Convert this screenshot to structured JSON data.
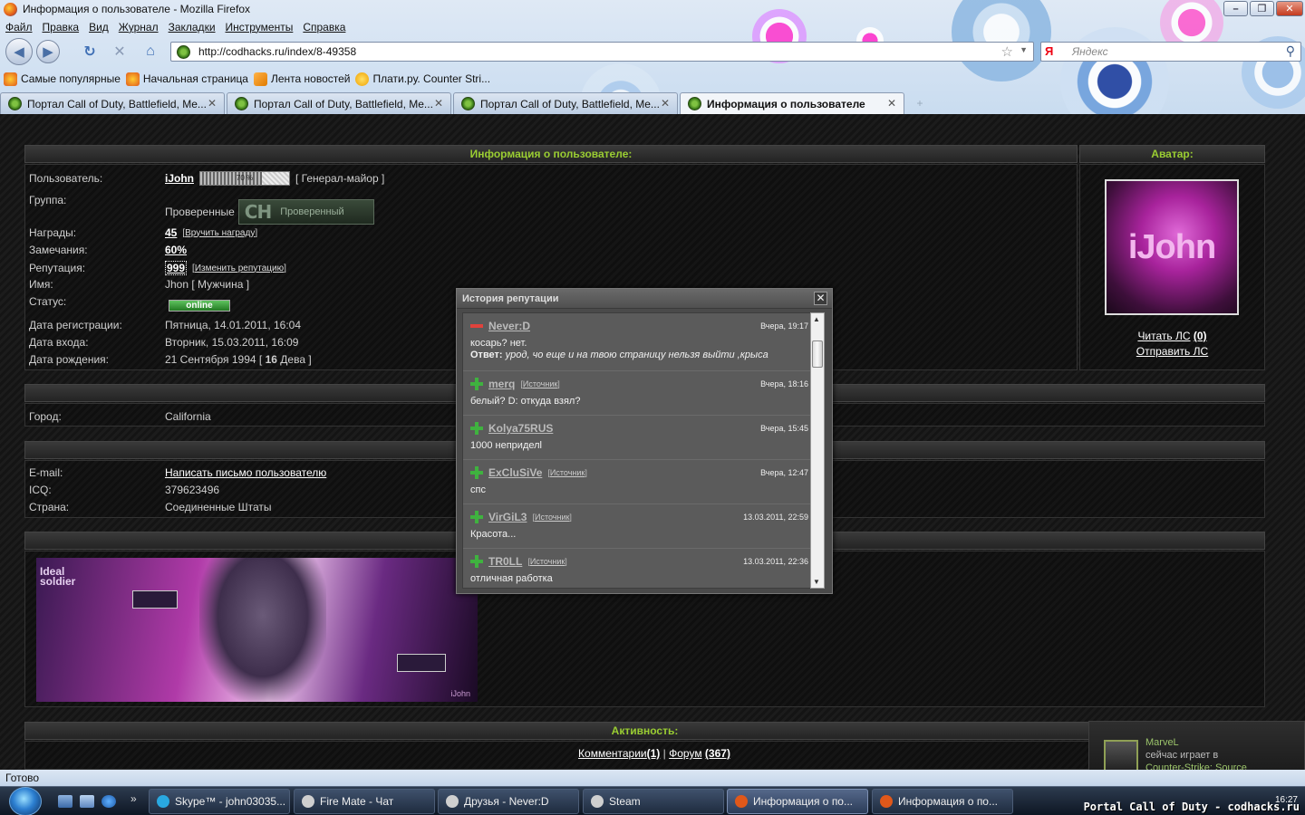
{
  "window": {
    "title": "Информация о пользователе - Mozilla Firefox"
  },
  "menubar": [
    "Файл",
    "Правка",
    "Вид",
    "Журнал",
    "Закладки",
    "Инструменты",
    "Справка"
  ],
  "navbar": {
    "url": "http://codhacks.ru/index/8-49358",
    "search_placeholder": "Яндекс",
    "search_engine_logo": "Я"
  },
  "bookmarks": [
    "Самые популярные",
    "Начальная страница",
    "Лента новостей",
    "Плати.ру. Counter Stri..."
  ],
  "tabs": [
    {
      "label": "Портал Call of Duty, Battlefield, Me...",
      "active": false
    },
    {
      "label": "Портал Call of Duty, Battlefield, Me...",
      "active": false
    },
    {
      "label": "Портал Call of Duty, Battlefield, Me...",
      "active": false
    },
    {
      "label": "Информация о пользователе",
      "active": true
    }
  ],
  "profile": {
    "header": "Информация о пользователе:",
    "avatar_header": "Аватар:",
    "user_label": "Пользователь:",
    "user_name": "iJohn",
    "rank_bar_text": "70 %",
    "rank": "[ Генерал-майор ]",
    "group_label": "Группа:",
    "group": "Проверенные",
    "group_badge_letters": "CH",
    "group_badge_text": "Проверенный",
    "awards_label": "Награды:",
    "awards": "45",
    "awards_action": "Вручить награду",
    "warnings_label": "Замечания:",
    "warnings": "60%",
    "reputation_label": "Репутация:",
    "reputation": "999",
    "reputation_action": "Изменить репутацию",
    "name_label": "Имя:",
    "name": "Jhon [ Мужчина ]",
    "status_label": "Статус:",
    "status": "online",
    "reg_label": "Дата регистрации:",
    "reg_date": "Пятница, 14.01.2011, 16:04",
    "login_label": "Дата входа:",
    "login_date": "Вторник, 15.03.2011, 16:09",
    "birth_label": "Дата рождения:",
    "birth_pre": "21 Сентября 1994 [ ",
    "birth_age": "16",
    "birth_post": " Дева ]",
    "avatar_text": "iJohn",
    "read_pm": "Читать ЛС",
    "read_pm_count": "(0)",
    "send_pm": "Отправить ЛС"
  },
  "location": {
    "city_label": "Город:",
    "city": "California"
  },
  "contacts": {
    "email_label": "E-mail:",
    "email_link": "Написать письмо пользователю",
    "icq_label": "ICQ:",
    "icq": "379623496",
    "country_label": "Страна:",
    "country": "Соединенные Штаты"
  },
  "signature": {
    "title_line1": "Ideal",
    "title_line2": "soldier",
    "author": "iJohn"
  },
  "activity": {
    "header": "Активность:",
    "comments_label": "Комментарии",
    "comments_count": "(1)",
    "separator": "|",
    "forum_label": "Форум",
    "forum_count": "(367)"
  },
  "modal": {
    "title": "История репутации",
    "items": [
      {
        "sign": "minus",
        "user": "Never:D",
        "source": "",
        "date": "Вчера, 19:17",
        "text": "косарь? нет.",
        "answer_label": "Ответ:",
        "answer": "урод, чо еще и на твою страницу нельзя выйти ,крыса"
      },
      {
        "sign": "plus",
        "user": "merq",
        "source": "Источник",
        "date": "Вчера, 18:16",
        "text": "белый? D: откуда взял?",
        "answer_label": "",
        "answer": ""
      },
      {
        "sign": "plus",
        "user": "Kolya75RUS",
        "source": "",
        "date": "Вчера, 15:45",
        "text": "1000 неприделl",
        "answer_label": "",
        "answer": ""
      },
      {
        "sign": "plus",
        "user": "ExCluSiVe",
        "source": "Источник",
        "date": "Вчера, 12:47",
        "text": "спс",
        "answer_label": "",
        "answer": ""
      },
      {
        "sign": "plus",
        "user": "VirGiL3",
        "source": "Источник",
        "date": "13.03.2011, 22:59",
        "text": "Красота...",
        "answer_label": "",
        "answer": ""
      },
      {
        "sign": "plus",
        "user": "TR0LL",
        "source": "Источник",
        "date": "13.03.2011, 22:36",
        "text": "отличная работка",
        "answer_label": "",
        "answer": ""
      }
    ]
  },
  "statusbar": {
    "text": "Готово"
  },
  "steam_toast": {
    "user": "MarveL",
    "middle": "сейчас играет в",
    "game": "Counter-Strike: Source"
  },
  "taskbar": {
    "tasks": [
      {
        "label": "Skype™ - john03035...",
        "active": false,
        "color": "#29a8e0"
      },
      {
        "label": "Fire Mate - Чат",
        "active": false,
        "color": "#cfcfcf"
      },
      {
        "label": "Друзья - Never:D",
        "active": false,
        "color": "#cfcfcf"
      },
      {
        "label": "Steam",
        "active": false,
        "color": "#cfcfcf"
      },
      {
        "label": "Информация о по...",
        "active": true,
        "color": "#e0581a"
      },
      {
        "label": "Информация о по...",
        "active": false,
        "color": "#e0581a"
      }
    ],
    "time": "16:27",
    "watermark": "Portal Call of Duty - codhacks.ru"
  }
}
